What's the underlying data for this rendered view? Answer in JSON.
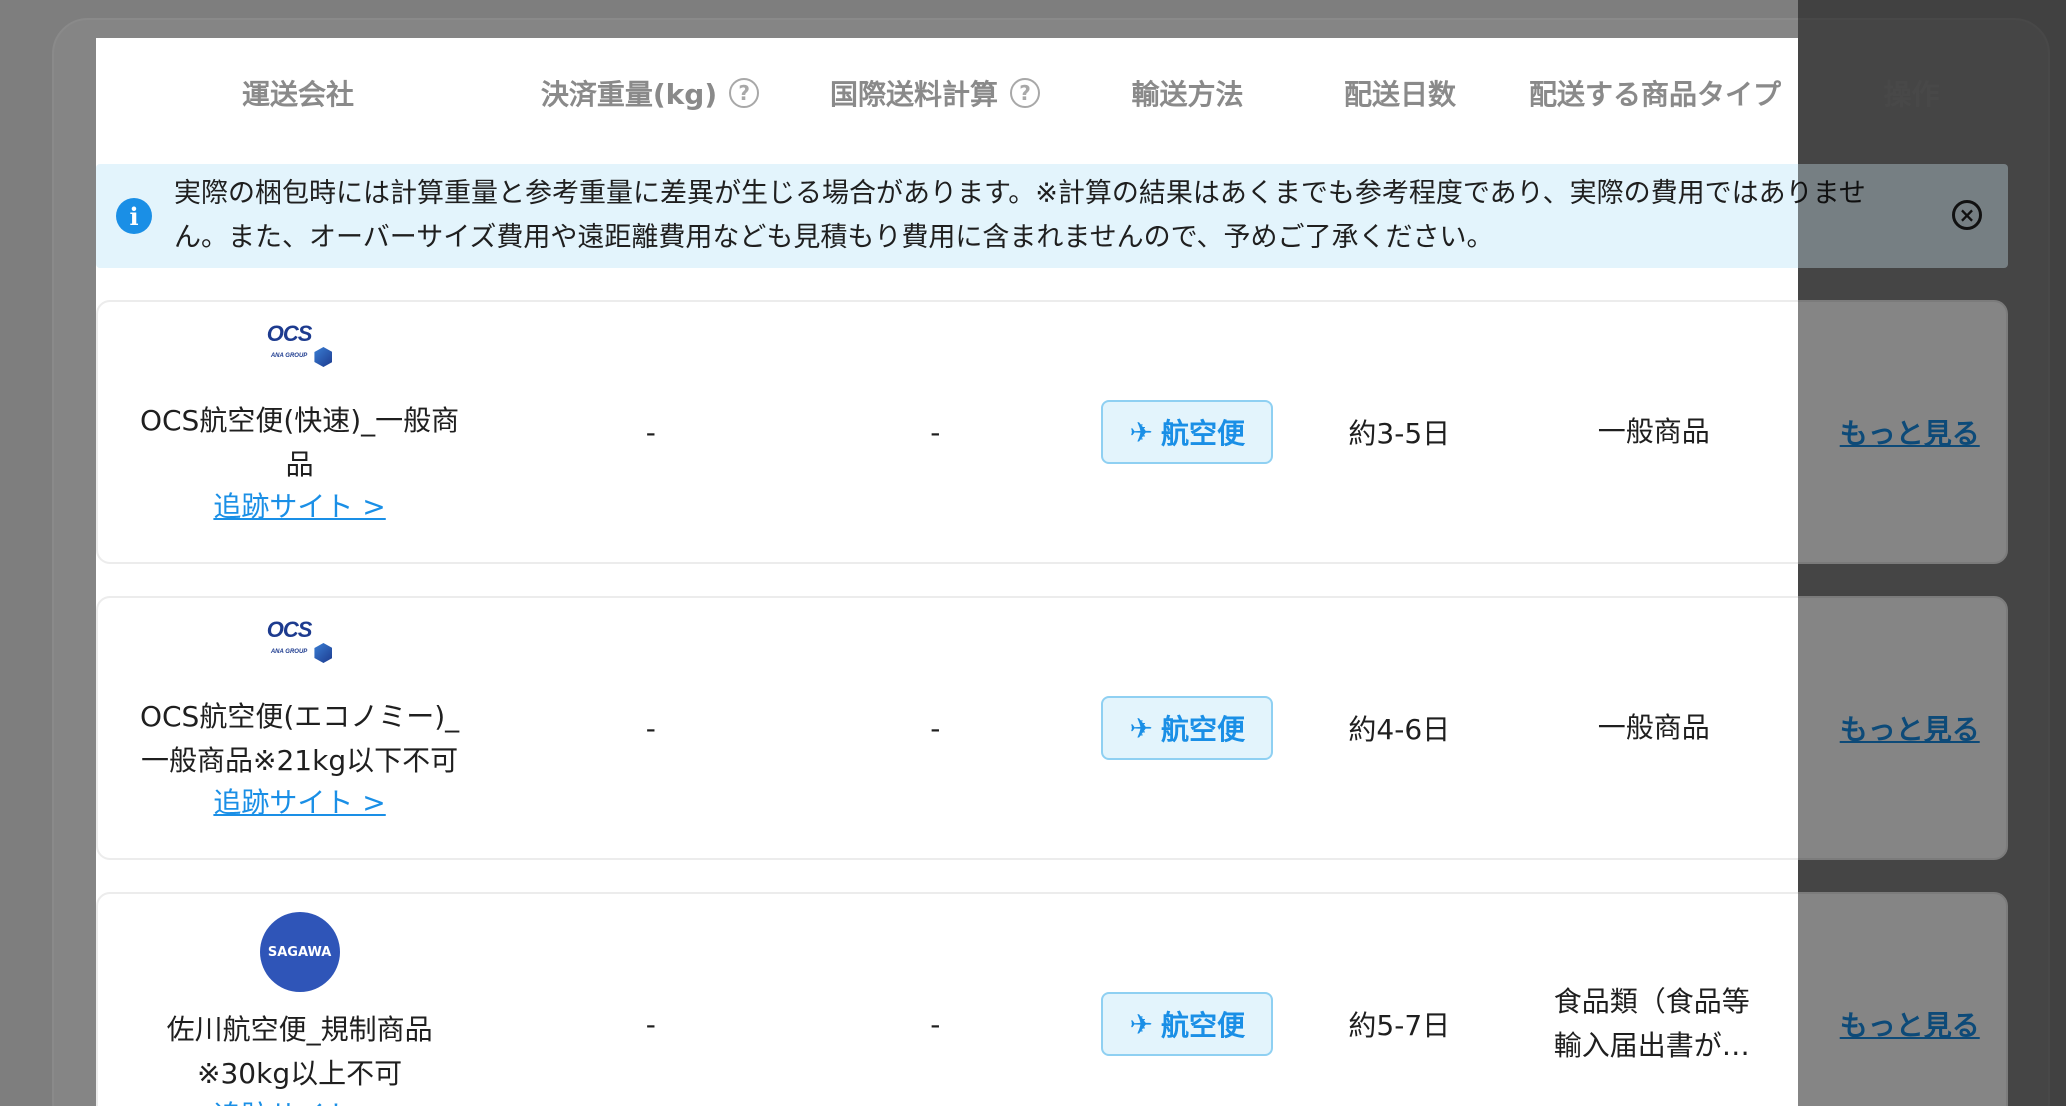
{
  "columns": {
    "carrier": "運送会社",
    "weight": "決済重量(kg)",
    "intl_fee": "国際送料計算",
    "method": "輸送方法",
    "days": "配送日数",
    "product_type": "配送する商品タイプ",
    "action": "操作"
  },
  "alert": {
    "text": "実際の梱包時には計算重量と参考重量に差異が生じる場合があります。※計算の結果はあくまでも参考程度であり、実際の費用ではありません。また、オーバーサイズ費用や遠距離費用なども見積もり費用に含まれませんので、予めご了承ください。",
    "icon": "info-icon"
  },
  "rows": [
    {
      "logo": "OCS",
      "logo_sub": "ANA GROUP",
      "name": "OCS航空便(快速)_一般商品",
      "track": "追跡サイト >",
      "weight": "-",
      "fee": "-",
      "method": "航空便",
      "days": "約3-5日",
      "type": "一般商品",
      "action": "もっと見る"
    },
    {
      "logo": "OCS",
      "logo_sub": "ANA GROUP",
      "name": "OCS航空便(エコノミー)_一般商品※21kg以下不可",
      "track": "追跡サイト >",
      "weight": "-",
      "fee": "-",
      "method": "航空便",
      "days": "約4-6日",
      "type": "一般商品",
      "action": "もっと見る"
    },
    {
      "logo": "SAGAWA",
      "name": "佐川航空便_規制商品※30kg以上不可",
      "track": "追跡サイト >",
      "weight": "-",
      "fee": "-",
      "method": "航空便",
      "days": "約5-7日",
      "type": "食品類（食品等輸入届出書が…",
      "action": "もっと見る"
    }
  ],
  "colors": {
    "accent": "#1a8fe6",
    "alert_bg": "#e3f4fc",
    "sagawa_blue": "#2f55b8",
    "ocs_navy": "#1d3b8f"
  }
}
